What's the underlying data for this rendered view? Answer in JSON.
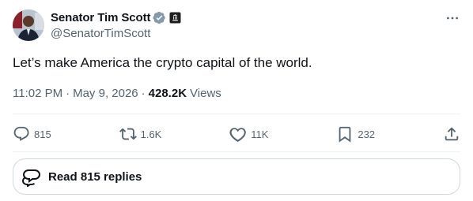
{
  "author": {
    "display_name": "Senator Tim Scott",
    "handle": "@SenatorTimScott",
    "verified": true,
    "verified_color": "#829aab",
    "gov_badge": true
  },
  "tweet": {
    "text": "Let’s make America the crypto capital of the world.",
    "time": "11:02 PM",
    "separator": "·",
    "date": "May 9, 2026",
    "views_count": "428.2K",
    "views_label": "Views"
  },
  "actions": {
    "reply_count": "815",
    "repost_count": "1.6K",
    "like_count": "11K",
    "bookmark_count": "232"
  },
  "replies": {
    "label": "Read 815 replies"
  },
  "colors": {
    "text_primary": "#0f1419",
    "text_secondary": "#536471",
    "border": "#cfd9de"
  }
}
